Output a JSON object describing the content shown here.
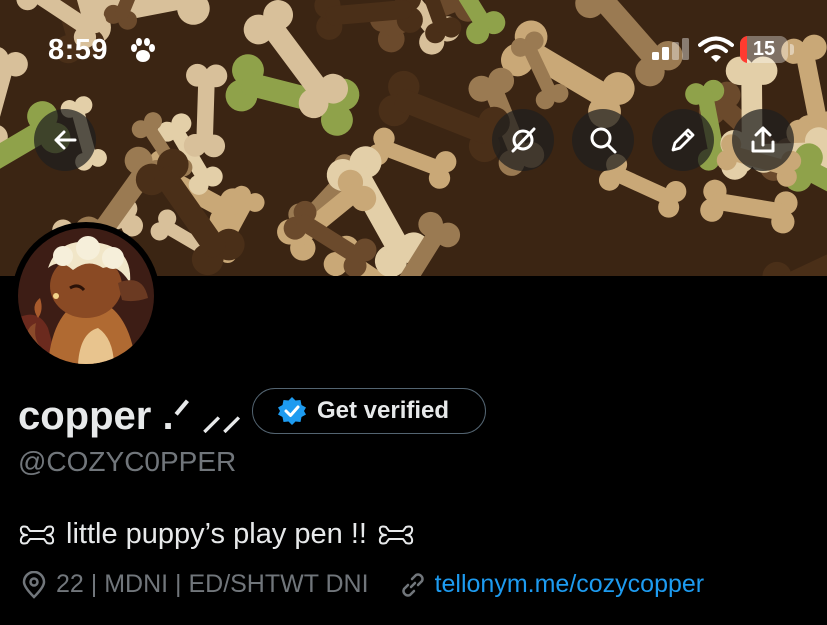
{
  "status_bar": {
    "time": "8:59",
    "battery_level": "15",
    "battery_fraction": 0.15
  },
  "header": {
    "buttons": [
      {
        "name": "back-button",
        "icon": "arrow-left-icon"
      },
      {
        "name": "grok-button",
        "icon": "grok-icon"
      },
      {
        "name": "search-button",
        "icon": "search-icon"
      },
      {
        "name": "edit-button",
        "icon": "pencil-icon"
      },
      {
        "name": "share-button",
        "icon": "share-icon"
      }
    ]
  },
  "profile": {
    "display_name": "copper .ᐟ ⸝⸝",
    "verify_label": "Get verified",
    "handle": "@COZYC0PPER",
    "bio": "little puppy’s play pen !!",
    "bio_icon": "bone-icon",
    "location": "22 | MDNI  | ED/SHTWT DNI",
    "website": "tellonym.me/cozycopper"
  },
  "colors": {
    "accent": "#1d9bf0",
    "muted": "#71767b",
    "text": "#e7e9ea",
    "background": "#000000",
    "battery": "#ff3b30"
  }
}
